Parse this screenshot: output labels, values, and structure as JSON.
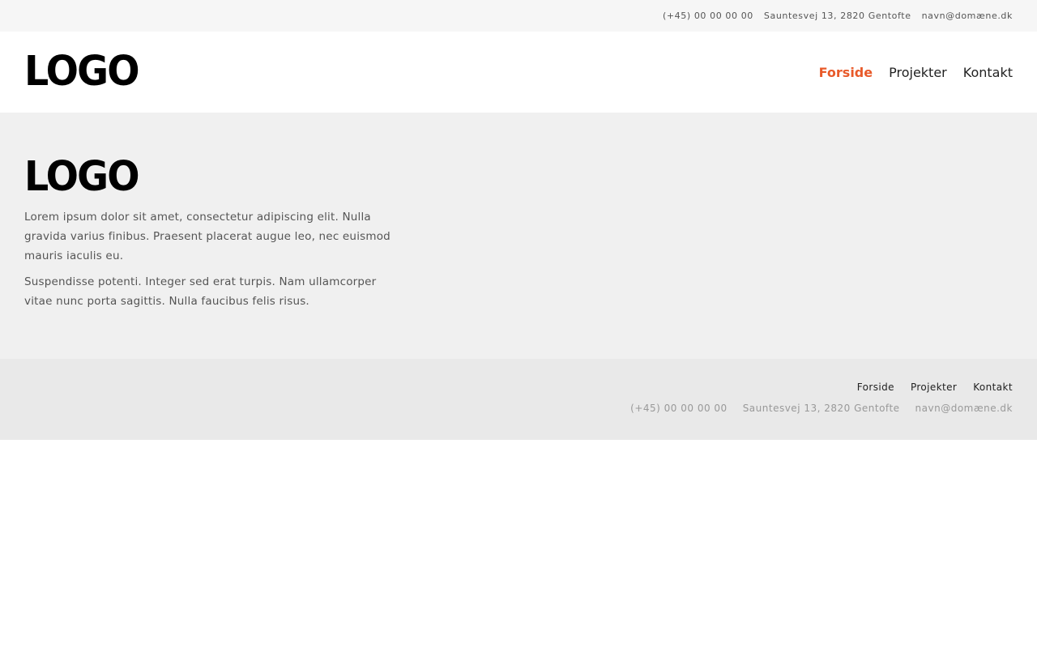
{
  "topbar": {
    "phone": "(+45) 00 00 00 00",
    "address": "Sauntesvej 13, 2820 Gentofte",
    "email": "navn@domæne.dk"
  },
  "header": {
    "logo": "LOGO",
    "nav": [
      {
        "label": "Forside",
        "active": true
      },
      {
        "label": "Projekter",
        "active": false
      },
      {
        "label": "Kontakt",
        "active": false
      }
    ]
  },
  "hero": {
    "logo": "LOGO",
    "paragraphs": [
      "Lorem ipsum dolor sit amet, consectetur adipiscing elit. Nulla gravida varius finibus. Praesent placerat augue leo, nec euismod mauris iaculis eu.",
      "Suspendisse potenti. Integer sed erat turpis. Nam ullamcorper vitae nunc porta sagittis. Nulla faucibus felis risus."
    ]
  },
  "footer": {
    "nav": [
      {
        "label": "Forside"
      },
      {
        "label": "Projekter"
      },
      {
        "label": "Kontakt"
      }
    ],
    "phone": "(+45) 00 00 00 00",
    "address": "Sauntesvej 13, 2820 Gentofte",
    "email": "navn@domæne.dk"
  },
  "colors": {
    "accent": "#e85a2a",
    "topbar_bg": "#f6f6f6",
    "hero_bg": "#f0f0f0",
    "footer_bg": "#e9e9e9"
  }
}
